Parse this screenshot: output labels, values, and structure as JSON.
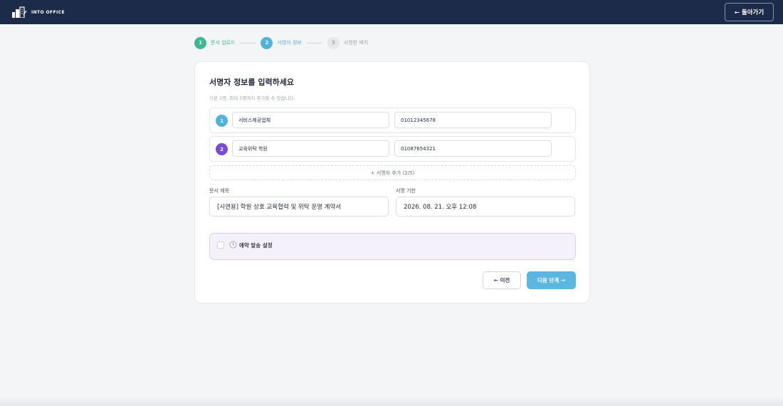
{
  "header": {
    "brand": "INTO OFFICE",
    "back_label": "← 돌아가기"
  },
  "stepper": {
    "steps": [
      {
        "number": "1",
        "label": "문서 업로드"
      },
      {
        "number": "2",
        "label": "서명자 정보"
      },
      {
        "number": "3",
        "label": "서명란 배치"
      }
    ]
  },
  "form": {
    "title": "서명자 정보를 입력하세요",
    "subtitle": "기본 2명, 최대 5명까지 추가할 수 있습니다.",
    "signers": [
      {
        "number": "1",
        "name": "서비스제공업체",
        "phone": "01012345678"
      },
      {
        "number": "2",
        "name": "교육위탁 학원",
        "phone": "01087654321"
      }
    ],
    "add_signer_label": "+ 서명자 추가 (2/5)",
    "doc_title_label": "문서 제목",
    "doc_title_value": "[시연용] 학원 상호 교육협력 및 위탁 운영 계약서",
    "deadline_label": "서명 기한",
    "deadline_value": "2026. 08. 21. 오후 12:08",
    "schedule_label": "예약 발송 설정",
    "prev_label": "← 이전",
    "next_label": "다음 단계 →"
  },
  "colors": {
    "header_bg": "#1c2b4a",
    "step_done": "#3fb68b",
    "step_active": "#4fb3dd",
    "signer2": "#7b4bd6",
    "primary_button": "#5bb6e0"
  },
  "icons": [
    "building-logo-icon",
    "clock-icon"
  ]
}
